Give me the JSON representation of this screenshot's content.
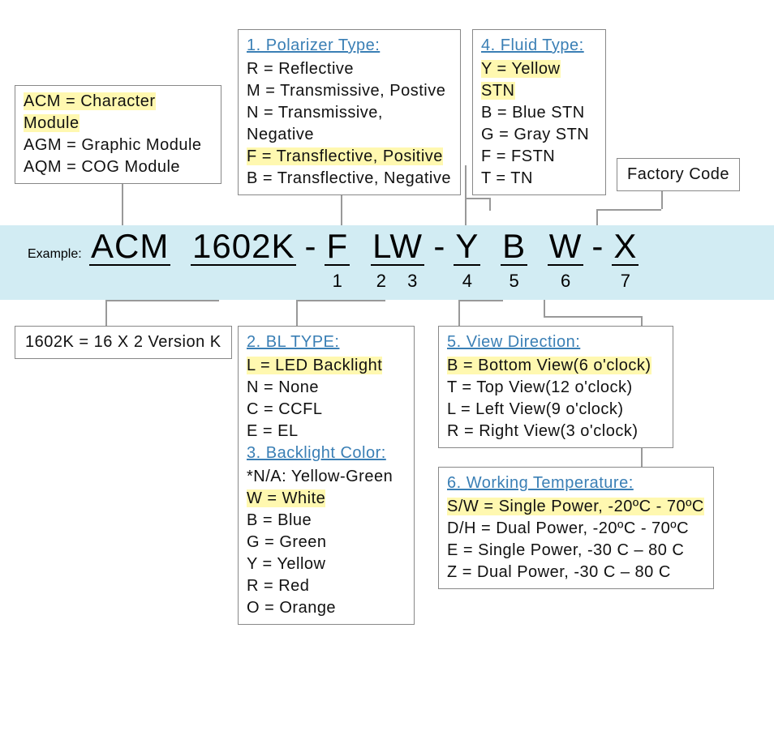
{
  "example_label": "Example:",
  "part_number": {
    "prefix": "ACM",
    "model": "1602K",
    "seg1": "F",
    "seg23": "LW",
    "seg4": "Y",
    "seg5": "B",
    "seg6": "W",
    "seg7": "X",
    "sub1": "1",
    "sub23": "2 3",
    "sub4": "4",
    "sub5": "5",
    "sub6": "6",
    "sub7": "7"
  },
  "module_box": {
    "line1": "ACM = Character Module",
    "line2": "AGM = Graphic Module",
    "line3": "AQM = COG Module"
  },
  "model_box": "1602K = 16 X 2 Version K",
  "factory_box": "Factory Code",
  "polarizer": {
    "title": "1. Polarizer Type:",
    "r": "R = Reflective",
    "m": "M = Transmissive, Postive",
    "n": "N = Transmissive, Negative",
    "f": "F = Transflective, Positive",
    "b": "B = Transflective, Negative"
  },
  "bl_type": {
    "title": "2. BL TYPE:",
    "l": "L = LED Backlight",
    "n": "N = None",
    "c": "C = CCFL",
    "e": "E = EL"
  },
  "bl_color": {
    "title": "3. Backlight Color:",
    "na": "*N/A: Yellow-Green",
    "w": "W = White",
    "b": "B = Blue",
    "g": "G = Green",
    "y": "Y = Yellow",
    "r": "R = Red",
    "o": "O = Orange"
  },
  "fluid": {
    "title": "4. Fluid Type:",
    "y": "Y = Yellow STN",
    "b": "B = Blue STN",
    "g": "G = Gray STN",
    "f": "F = FSTN",
    "t": "T = TN"
  },
  "view": {
    "title": "5. View Direction:",
    "b": "B = Bottom View(6 o'clock)",
    "t": "T = Top View(12 o'clock)",
    "l": "L = Left View(9 o'clock)",
    "r": "R = Right View(3 o'clock)"
  },
  "temp": {
    "title": "6. Working Temperature:",
    "sw": "S/W = Single Power, -20ºC - 70ºC",
    "dh": "D/H = Dual Power, -20ºC - 70ºC",
    "e": "E = Single Power, -30 C – 80 C",
    "z": "Z = Dual Power, -30 C – 80 C"
  }
}
